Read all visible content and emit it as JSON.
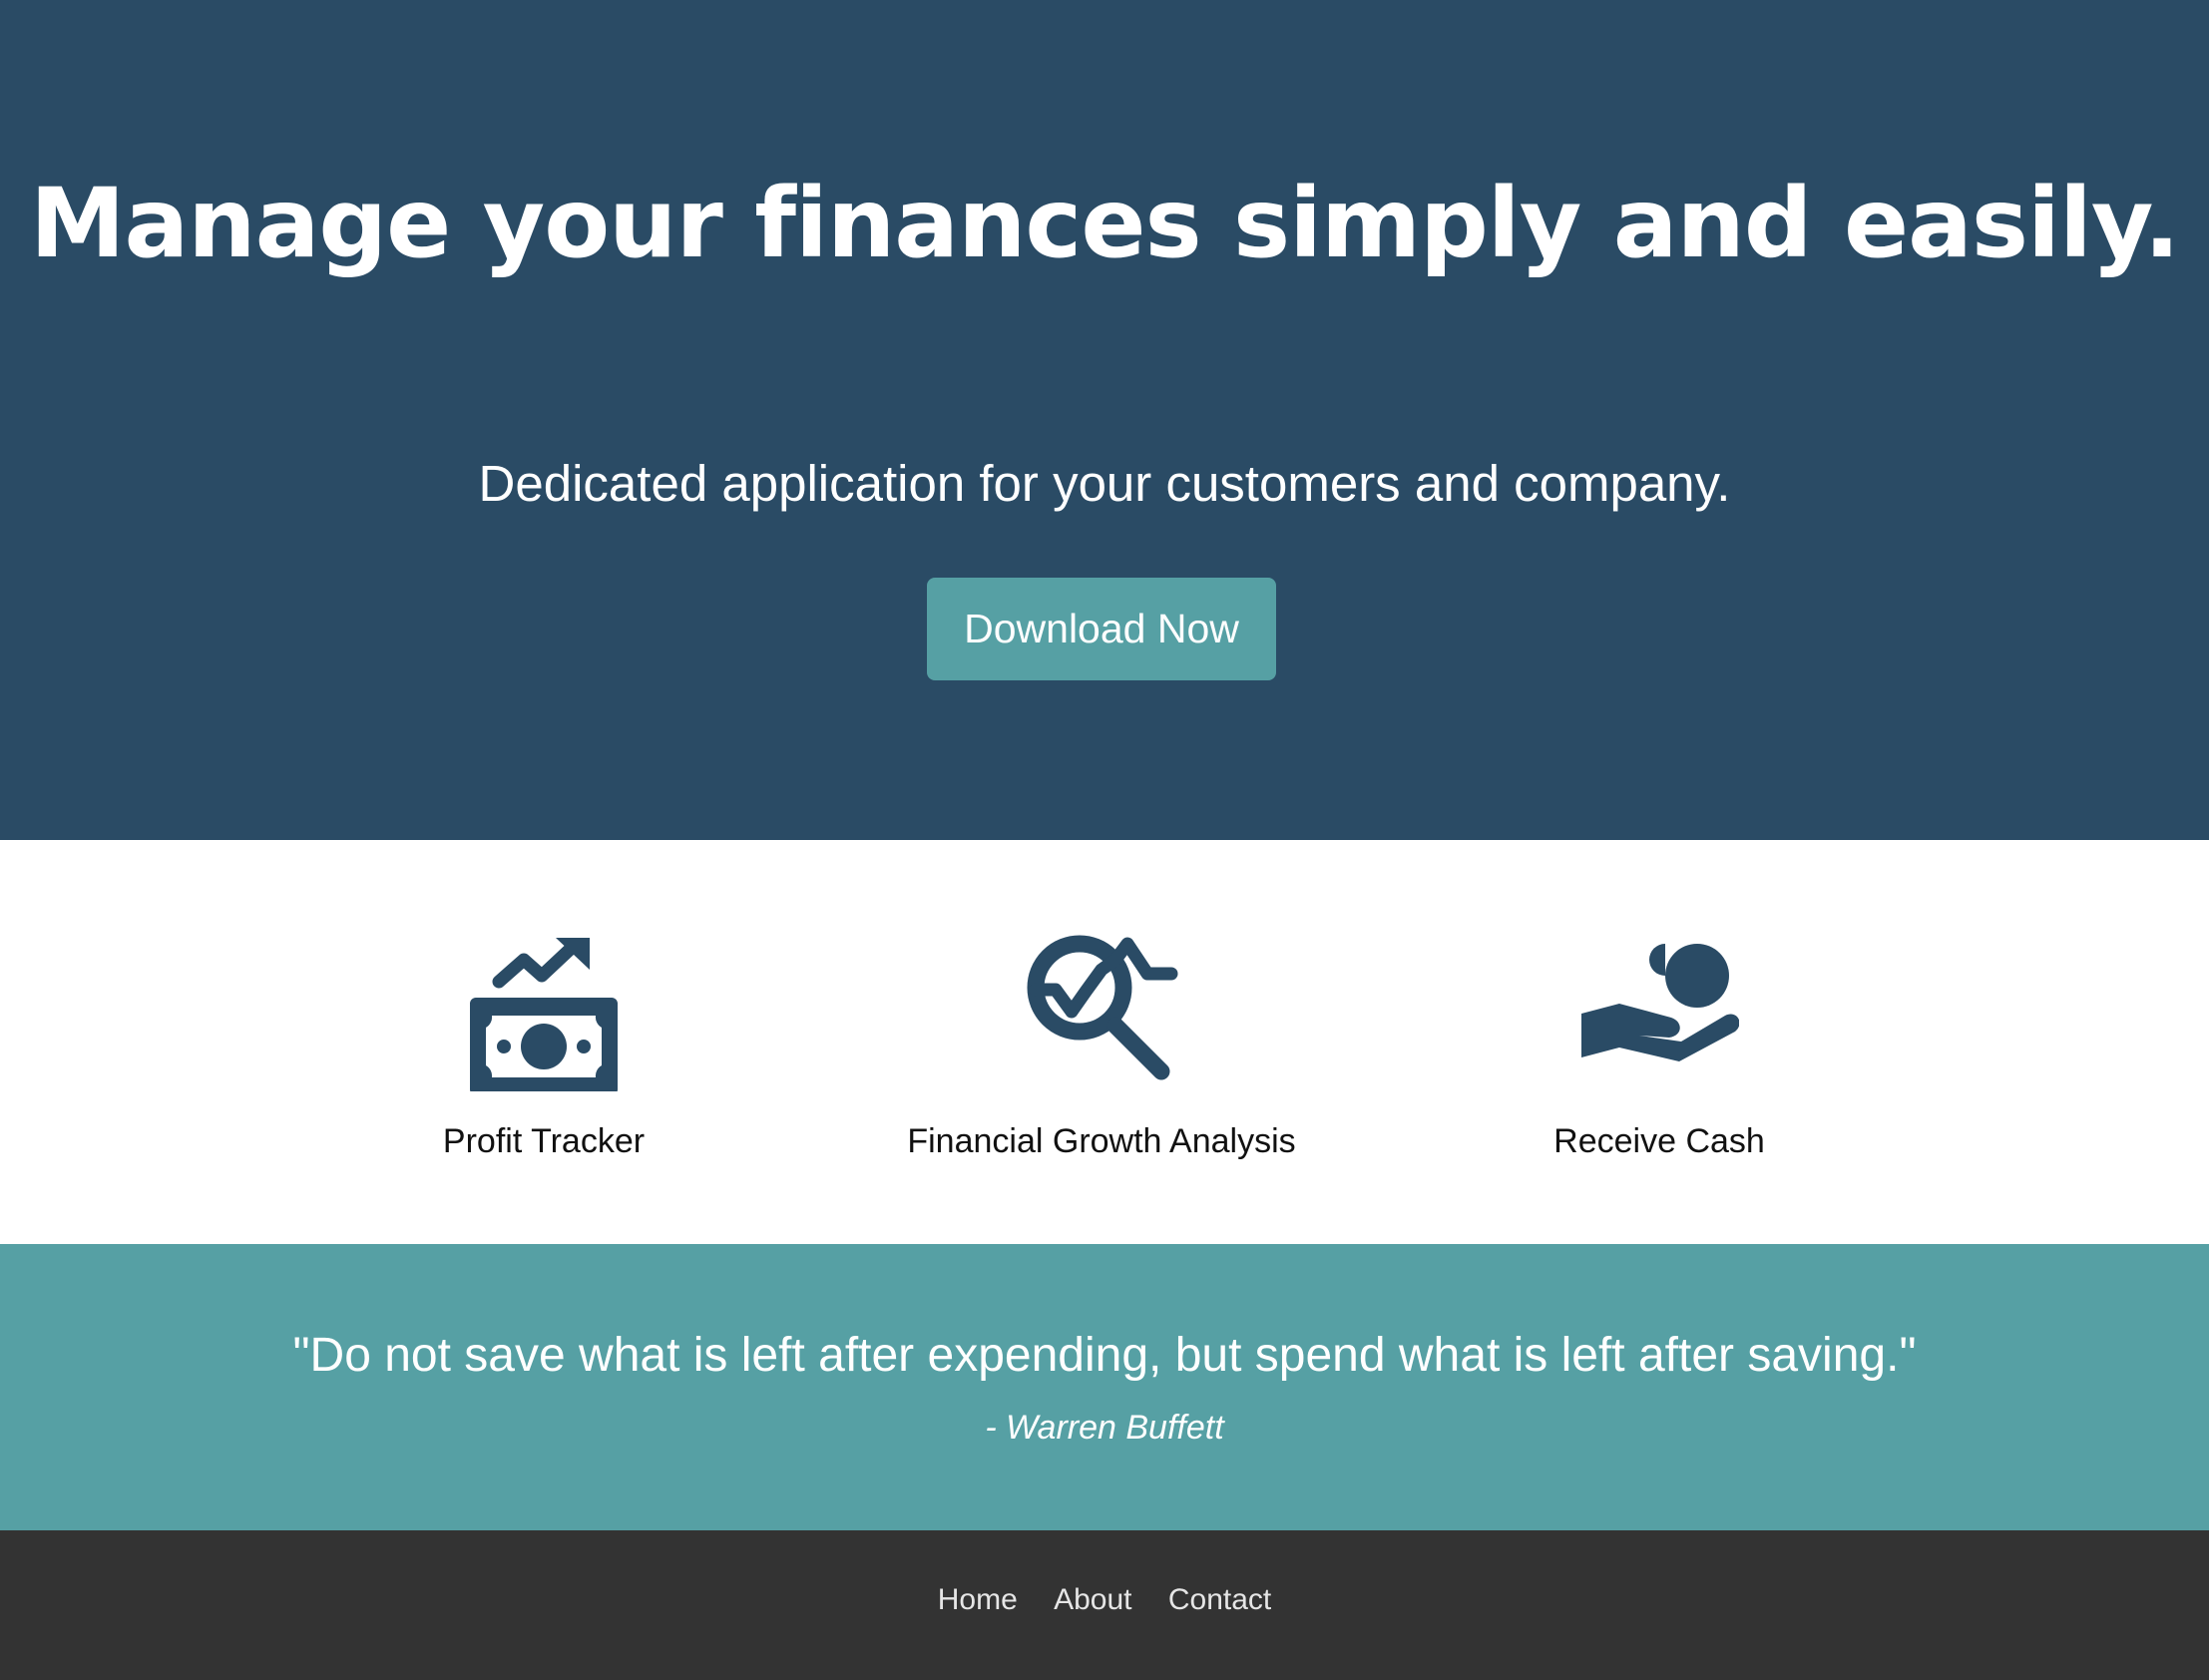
{
  "hero": {
    "title": "Manage your finances simply and easily.",
    "subtitle": "Dedicated application for your customers and company.",
    "cta_label": "Download Now",
    "background_color": "#2a4b65",
    "cta_color": "#56a0a4"
  },
  "features": [
    {
      "icon": "money-growth-icon",
      "label": "Profit Tracker"
    },
    {
      "icon": "magnifier-chart-icon",
      "label": "Financial Growth Analysis"
    },
    {
      "icon": "hand-coin-icon",
      "label": "Receive Cash"
    }
  ],
  "quote": {
    "text": "\"Do not save what is left after expending, but spend what is left after saving.\"",
    "author": "- Warren Buffett",
    "background_color": "#56a0a4"
  },
  "footer": {
    "links": [
      "Home",
      "About",
      "Contact"
    ],
    "background_color": "#333333"
  }
}
